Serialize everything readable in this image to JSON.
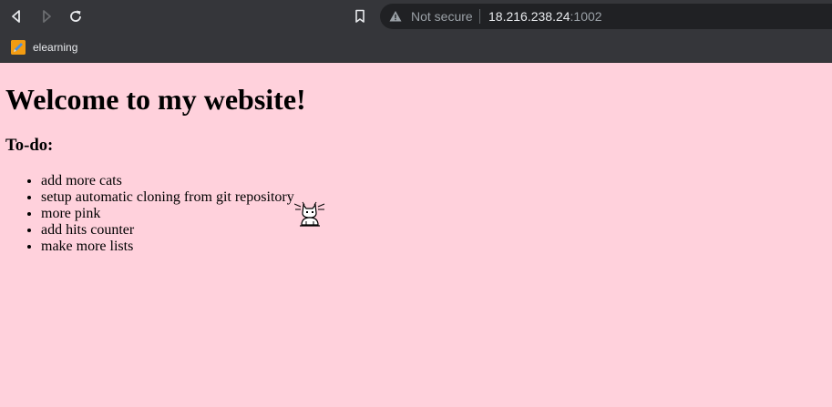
{
  "browser": {
    "security_text": "Not secure",
    "url_host": "18.216.238.24",
    "url_port": ":1002",
    "icons": {
      "back": "back-arrow-icon",
      "forward": "forward-arrow-icon",
      "reload": "reload-icon",
      "bookmark": "bookmark-icon",
      "security": "warning-triangle-icon"
    }
  },
  "bookmarks_bar": {
    "items": [
      {
        "label": "elearning",
        "icon": "pencil-favicon"
      }
    ]
  },
  "page": {
    "background_color": "#ffd1dc",
    "heading": "Welcome to my website!",
    "todo_heading": "To-do:",
    "todo_items": [
      "add more cats",
      "setup automatic cloning from git repository",
      "more pink",
      "add hits counter",
      "make more lists"
    ],
    "cursor_icon": "cat-cursor-icon"
  }
}
